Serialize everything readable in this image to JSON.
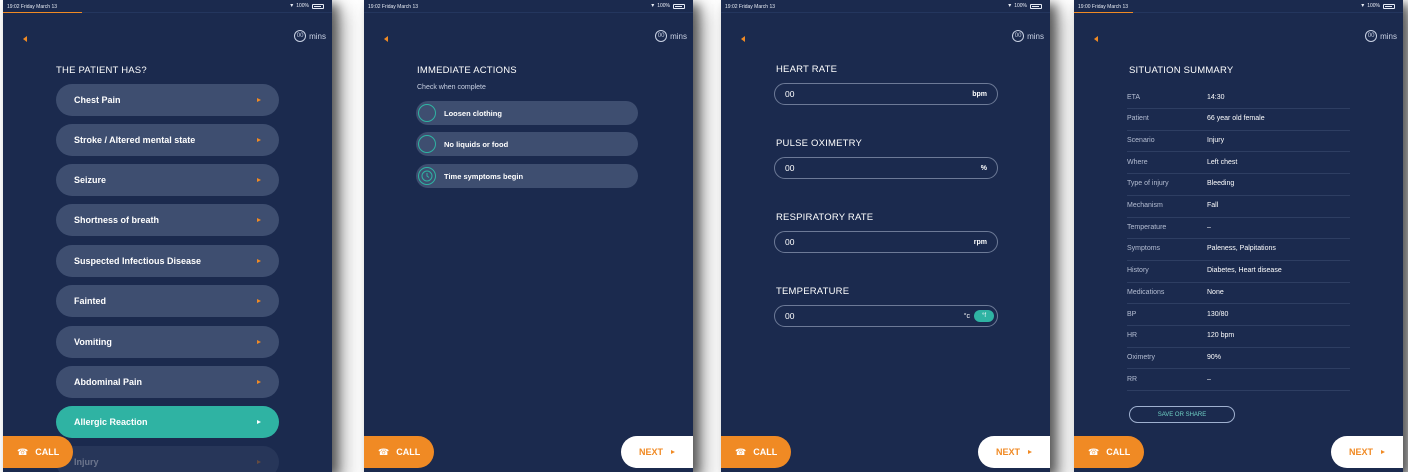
{
  "status": {
    "s1": {
      "time_date": "19:02  Friday March 13",
      "battery": "100%"
    },
    "s2": {
      "time_date": "19:02  Friday March 13",
      "battery": "100%"
    },
    "s3": {
      "time_date": "19:02  Friday March 13",
      "battery": "100%"
    },
    "s4": {
      "time_date": "19:00  Friday March 13",
      "battery": "100%"
    }
  },
  "timer": {
    "value": "00",
    "unit": "mins"
  },
  "call_label": "CALL",
  "next_label": "NEXT",
  "screen1": {
    "heading": "THE PATIENT HAS?",
    "options": [
      "Chest Pain",
      "Stroke / Altered mental state",
      "Seizure",
      "Shortness of breath",
      "Suspected Infectious Disease",
      "Fainted",
      "Vomiting",
      "Abdominal Pain",
      "Allergic Reaction",
      "Injury"
    ]
  },
  "screen2": {
    "heading": "IMMEDIATE ACTIONS",
    "subtext": "Check when complete",
    "actions": [
      "Loosen clothing",
      "No liquids or food",
      "Time symptoms begin"
    ]
  },
  "screen3": {
    "fields": [
      {
        "label": "HEART RATE",
        "value": "00",
        "unit": "bpm"
      },
      {
        "label": "PULSE OXIMETRY",
        "value": "00",
        "unit": "%"
      },
      {
        "label": "RESPIRATORY RATE",
        "value": "00",
        "unit": "rpm"
      },
      {
        "label": "TEMPERATURE",
        "value": "00",
        "unit_c": "°c",
        "unit_f": "°f"
      }
    ]
  },
  "screen4": {
    "heading": "SITUATION SUMMARY",
    "rows": [
      {
        "k": "ETA",
        "v": "14:30"
      },
      {
        "k": "Patient",
        "v": "66 year old female"
      },
      {
        "k": "Scenario",
        "v": "Injury"
      },
      {
        "k": "Where",
        "v": "Left chest"
      },
      {
        "k": "Type of injury",
        "v": "Bleeding"
      },
      {
        "k": "Mechanism",
        "v": "Fall"
      },
      {
        "k": "Temperature",
        "v": "–"
      },
      {
        "k": "Symptoms",
        "v": "Paleness, Palpitations"
      },
      {
        "k": "History",
        "v": "Diabetes, Heart disease"
      },
      {
        "k": "Medications",
        "v": "None"
      },
      {
        "k": "BP",
        "v": "130/80"
      },
      {
        "k": "HR",
        "v": "120 bpm"
      },
      {
        "k": "Oximetry",
        "v": "90%"
      },
      {
        "k": "RR",
        "v": "–"
      }
    ],
    "share_label": "SAVE OR SHARE"
  },
  "colors": {
    "background": "#1b2a4e",
    "accent": "#f08a24",
    "teal": "#2fb3a3",
    "pill": "#3e4e70"
  },
  "icons": {
    "back": "chevron-left-icon",
    "phone": "phone-icon",
    "wifi": "wifi-icon",
    "battery": "battery-icon",
    "timer": "timer-icon",
    "clock": "clock-icon"
  }
}
